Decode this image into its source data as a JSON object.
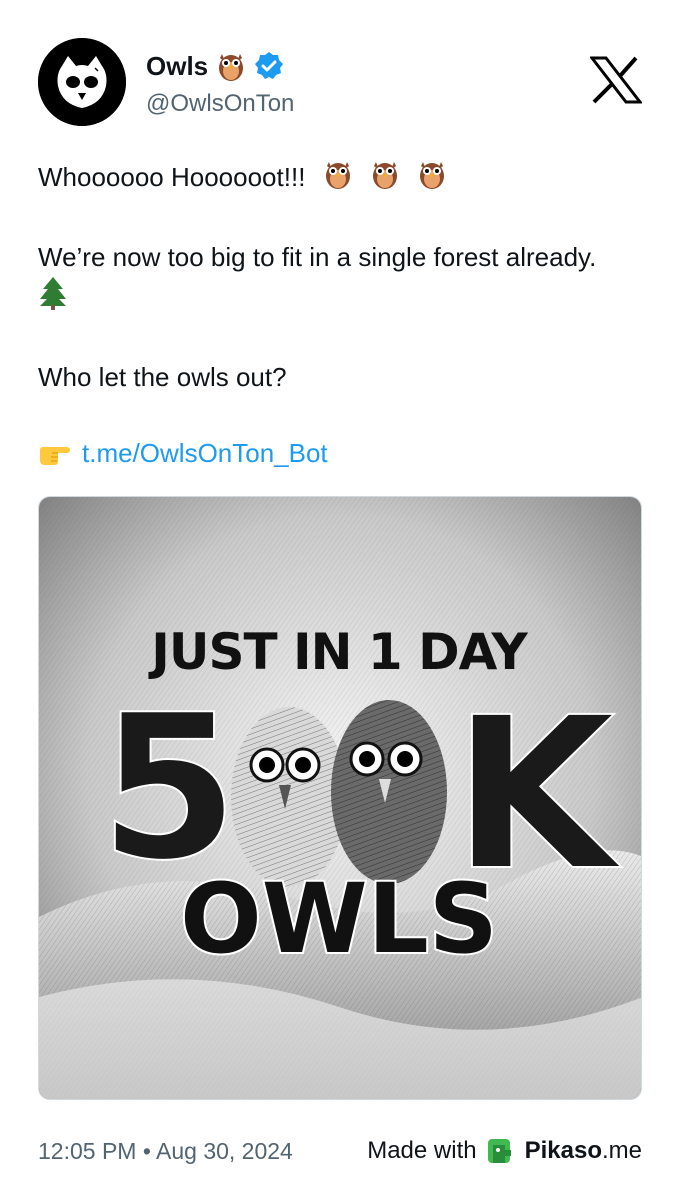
{
  "tweet": {
    "display_name": "Owls",
    "name_emoji": "owl-emoji",
    "handle": "@OwlsOnTon",
    "verified": true,
    "body": {
      "line1": "Whoooooo Hoooooot!!!",
      "line1_emojis": [
        "owl-emoji",
        "owl-emoji",
        "owl-emoji"
      ],
      "line2": "We’re now too big to fit in a single forest already.",
      "line2_emoji": "evergreen-tree-emoji",
      "line3": "Who let the owls out?",
      "link_emoji": "pointing-hand-emoji",
      "link": "t.me/OwlsOnTon_Bot"
    },
    "timestamp": "12:05 PM • Aug 30, 2024"
  },
  "media": {
    "headline": "JUST IN 1 DAY",
    "big_number_left": "5",
    "big_number_right": "K",
    "bottom_word": "OWLS"
  },
  "footer": {
    "made_with": "Made with",
    "brand": "Pikaso",
    "brand_suffix": ".me"
  },
  "colors": {
    "link": "#1d9bf0",
    "verified": "#1d9bf0",
    "muted": "#536471",
    "pikaso_green": "#3fb950"
  }
}
